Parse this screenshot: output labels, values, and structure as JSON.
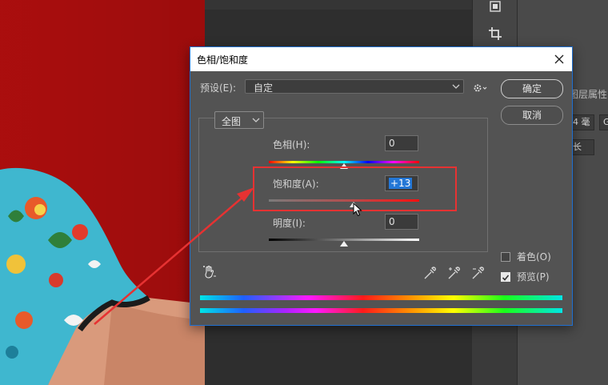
{
  "dialog": {
    "title": "色相/饱和度",
    "preset_label": "预设(E):",
    "preset_value": "自定",
    "ok_label": "确定",
    "cancel_label": "取消",
    "edit_channel": "全图",
    "hue": {
      "label": "色相(H):",
      "value": "0"
    },
    "saturation": {
      "label": "饱和度(A):",
      "value": "+13"
    },
    "lightness": {
      "label": "明度(I):",
      "value": "0"
    },
    "colorize_label": "着色(O)",
    "preview_label": "预览(P)",
    "colorize_checked": false,
    "preview_checked": true
  },
  "panel": {
    "tab_label": "图层属性",
    "field1": "4 毫",
    "field2": "G",
    "field3": "长"
  },
  "icons": {
    "toolbar": [
      "layer-icon",
      "crop-icon"
    ],
    "dialog": [
      "close-icon",
      "gear-icon",
      "chevron-down-icon",
      "hand-adjust-icon",
      "eyedropper-icon",
      "eyedropper-plus-icon",
      "eyedropper-minus-icon"
    ]
  },
  "colors": {
    "accent": "#1f6fd1",
    "annotation": "#e63232",
    "canvas_red": "#b10e0e"
  }
}
